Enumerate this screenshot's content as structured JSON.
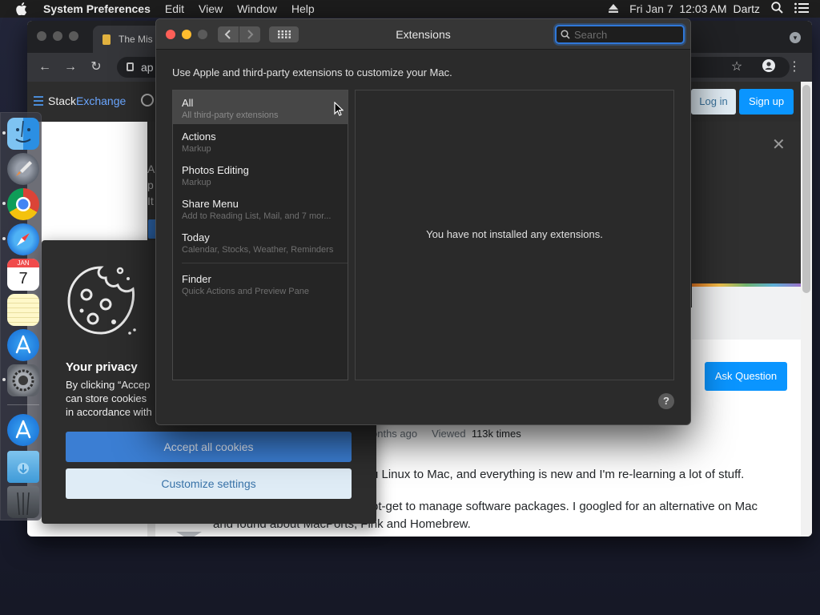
{
  "menubar": {
    "app_name": "System Preferences",
    "items": [
      "Edit",
      "View",
      "Window",
      "Help"
    ],
    "clock": "Fri Jan 7  12:03 AM",
    "user": "Dartz",
    "icons": [
      "apple-icon",
      "eject-icon",
      "spotlight-icon",
      "notification-list-icon"
    ]
  },
  "browser": {
    "tab_title": "The Mis",
    "address": "ap",
    "site": {
      "logo_stack": "Stack",
      "logo_exchange": "Exchange",
      "login_label": "Log in",
      "signup_label": "Sign up",
      "banner_letters": [
        "A",
        "p",
        "It"
      ],
      "ask_question_label": "Ask Question",
      "meta_asked": "onths ago",
      "meta_viewed_label": "Viewed",
      "meta_viewed_value": "113k times",
      "paragraph_1": "u Linux to Mac, and everything is new and I'm re-learning a lot of stuff.",
      "paragraph_2": "pt-get to manage software packages. I googled for an alternative on Mac",
      "paragraph_3": "and found about MacPorts, Fink and Homebrew."
    }
  },
  "cookie": {
    "title": "Your privacy",
    "body_line_1": "By clicking “Accep",
    "body_line_2": "can store cookies",
    "body_line_3": "in accordance with",
    "accept_label": "Accept all cookies",
    "customize_label": "Customize settings"
  },
  "dock": {
    "items": [
      "finder-icon",
      "launchpad-icon",
      "chrome-icon",
      "safari-icon",
      "calendar-icon",
      "notes-icon",
      "app-store-icon",
      "system-preferences-icon",
      "app-store-download-icon",
      "downloads-folder-icon",
      "trash-icon"
    ],
    "calendar_month": "JAN",
    "calendar_day": "7"
  },
  "prefs": {
    "title": "Extensions",
    "search_placeholder": "Search",
    "subtitle": "Use Apple and third-party extensions to customize your Mac.",
    "list": [
      {
        "name": "All",
        "desc": "All third-party extensions",
        "selected": true
      },
      {
        "name": "Actions",
        "desc": "Markup",
        "selected": false
      },
      {
        "name": "Photos Editing",
        "desc": "Markup",
        "selected": false
      },
      {
        "name": "Share Menu",
        "desc": "Add to Reading List, Mail, and 7 mor...",
        "selected": false
      },
      {
        "name": "Today",
        "desc": "Calendar, Stocks, Weather, Reminders",
        "selected": false
      },
      {
        "name": "Finder",
        "desc": "Quick Actions and Preview Pane",
        "selected": false
      }
    ],
    "empty_message": "You have not installed any extensions.",
    "help_label": "?"
  },
  "colors": {
    "accent_blue": "#2f77d8",
    "close_red": "#fe5f57",
    "minimize_yellow": "#febc2e",
    "so_blue": "#0a95ff"
  }
}
